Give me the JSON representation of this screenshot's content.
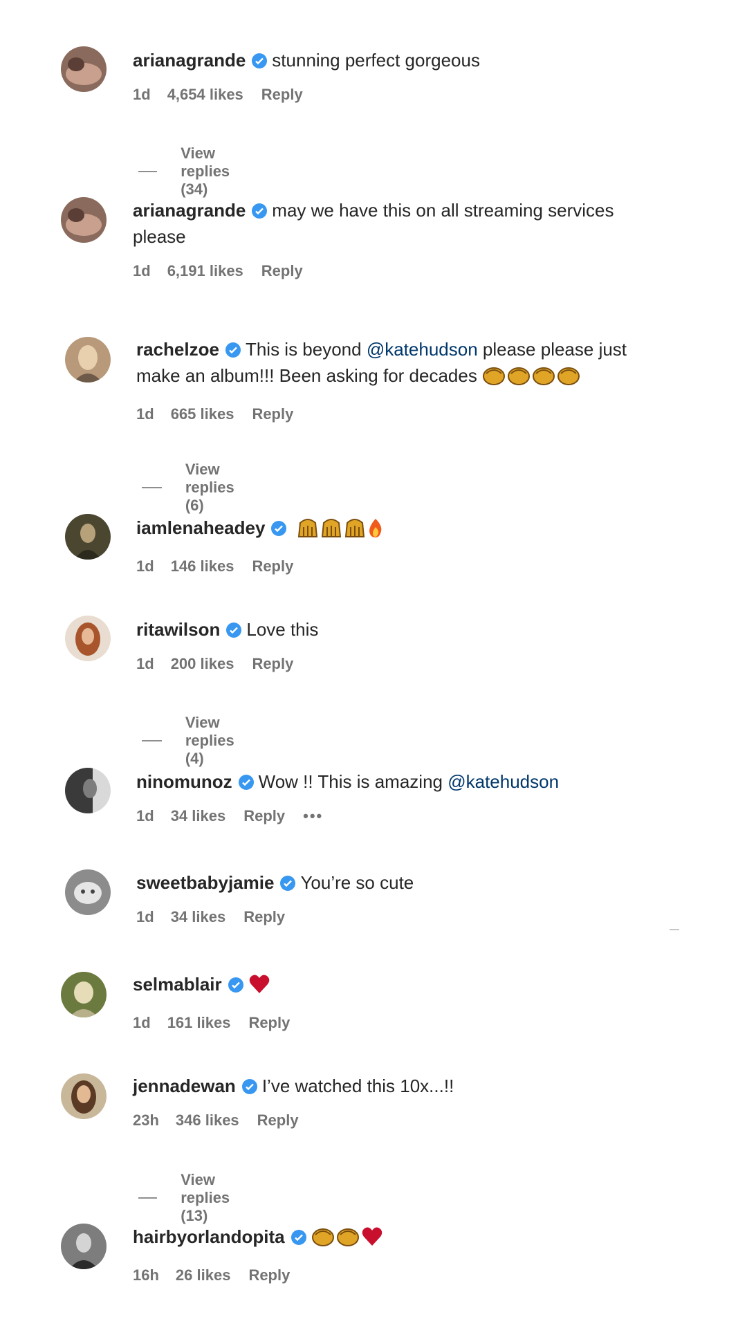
{
  "colors": {
    "verified": "#3897f0",
    "mention": "#00376b",
    "meta": "#737373",
    "heart": "#c8102e",
    "clap": "#e0a526"
  },
  "comments": [
    {
      "username": "arianagrande",
      "text": "stunning perfect gorgeous",
      "time": "1d",
      "likes": "4,654 likes",
      "reply": "Reply",
      "view_replies": "View replies (34)"
    },
    {
      "username": "arianagrande",
      "text": "may we have this on all streaming services please",
      "time": "1d",
      "likes": "6,191 likes",
      "reply": "Reply"
    },
    {
      "username": "rachelzoe",
      "text_pre": "This is beyond ",
      "mention": "@katehudson",
      "text_post": " please please just make an album!!! Been asking for decades",
      "emoji": [
        "clap-icon",
        "clap-icon",
        "clap-icon",
        "clap-icon"
      ],
      "time": "1d",
      "likes": "665 likes",
      "reply": "Reply",
      "view_replies": "View replies (6)"
    },
    {
      "username": "iamlenaheadey",
      "emoji": [
        "raised-hands-icon",
        "raised-hands-icon",
        "raised-hands-icon",
        "fire-icon"
      ],
      "time": "1d",
      "likes": "146 likes",
      "reply": "Reply"
    },
    {
      "username": "ritawilson",
      "text": "Love this",
      "time": "1d",
      "likes": "200 likes",
      "reply": "Reply",
      "view_replies": "View replies (4)"
    },
    {
      "username": "ninomunoz",
      "text_pre": "Wow !! This is amazing ",
      "mention": "@katehudson",
      "time": "1d",
      "likes": "34 likes",
      "reply": "Reply",
      "more": "•••"
    },
    {
      "username": "sweetbabyjamie",
      "text": "You’re so cute",
      "time": "1d",
      "likes": "34 likes",
      "reply": "Reply"
    },
    {
      "username": "selmablair",
      "emoji": [
        "heart-icon"
      ],
      "time": "1d",
      "likes": "161 likes",
      "reply": "Reply"
    },
    {
      "username": "jennadewan",
      "text": "I’ve watched this 10x...!!",
      "time": "23h",
      "likes": "346 likes",
      "reply": "Reply",
      "view_replies": "View replies (13)"
    },
    {
      "username": "hairbyorlandopita",
      "emoji": [
        "clap-icon",
        "clap-icon",
        "heart-icon"
      ],
      "time": "16h",
      "likes": "26 likes",
      "reply": "Reply"
    }
  ]
}
